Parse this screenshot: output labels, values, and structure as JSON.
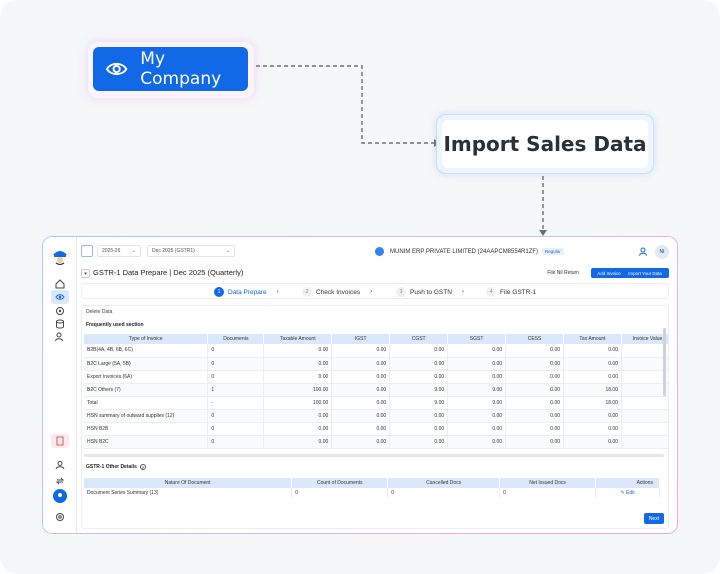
{
  "callouts": {
    "company_label": "My Company",
    "import_label": "Import Sales Data"
  },
  "topbar": {
    "fy_select": "2025-26",
    "period_select": "Dec 2025 (GSTR1)",
    "company_name": "MUNIM ERP PRIVATE LIMITED (24AAPCM8554R1ZF)",
    "company_badge": "Regular",
    "user_initials": "NI"
  },
  "title_row": {
    "page_title": "GSTR-1 Data Prepare | Dec 2025 (Quarterly)",
    "file_nil_return": "File Nil Return",
    "add_invoice": "Add Invoice",
    "import_your_data": "Import Your Data"
  },
  "steps": [
    {
      "num": "1",
      "label": "Data Prepare"
    },
    {
      "num": "2",
      "label": "Check Invoices"
    },
    {
      "num": "3",
      "label": "Push to GSTN"
    },
    {
      "num": "4",
      "label": "File GSTR-1"
    }
  ],
  "content": {
    "delete_data": "Delete Data",
    "frequent_header": "Frequently used section",
    "other_details_header": "GSTR-1 Other Details",
    "table1_columns": [
      "Type of Invoice",
      "Documents",
      "Taxable Amount",
      "IGST",
      "CGST",
      "SGST",
      "CESS",
      "Tax Amount",
      "Invoice Value"
    ],
    "table1_rows": [
      [
        "B2B(4A, 4B, 6B, 6C)",
        "0",
        "0.00",
        "0.00",
        "0.00",
        "0.00",
        "0.00",
        "0.00",
        ""
      ],
      [
        "B2C Large (5A, 5B)",
        "0",
        "0.00",
        "0.00",
        "0.00",
        "0.00",
        "0.00",
        "0.00",
        ""
      ],
      [
        "Export Invoices (6A)",
        "0",
        "0.00",
        "0.00",
        "0.00",
        "0.00",
        "0.00",
        "0.00",
        ""
      ],
      [
        "B2C Others (7)",
        "1",
        "100.00",
        "0.00",
        "9.00",
        "9.00",
        "0.00",
        "18.00",
        ""
      ],
      [
        "Total",
        "-",
        "100.00",
        "0.00",
        "9.00",
        "9.00",
        "0.00",
        "18.00",
        ""
      ],
      [
        "HSN summary of outward supplies (12)",
        "0",
        "0.00",
        "0.00",
        "0.00",
        "0.00",
        "0.00",
        "0.00",
        ""
      ],
      [
        "HSN B2B",
        "0",
        "0.00",
        "0.00",
        "0.00",
        "0.00",
        "0.00",
        "0.00",
        ""
      ],
      [
        "HSN B2C",
        "0",
        "0.00",
        "0.00",
        "0.00",
        "0.00",
        "0.00",
        "0.00",
        ""
      ]
    ],
    "table2_columns": [
      "Nature Of Document",
      "Count of Documents",
      "Cancelled Docs",
      "Net Issued Docs",
      "Actions"
    ],
    "table2_rows": [
      [
        "Document Series Summary (13)",
        "0",
        "0",
        "0",
        "Edit"
      ]
    ],
    "next_label": "Next"
  },
  "colors": {
    "accent": "#1269e8",
    "table_header": "#dbe8fb"
  }
}
